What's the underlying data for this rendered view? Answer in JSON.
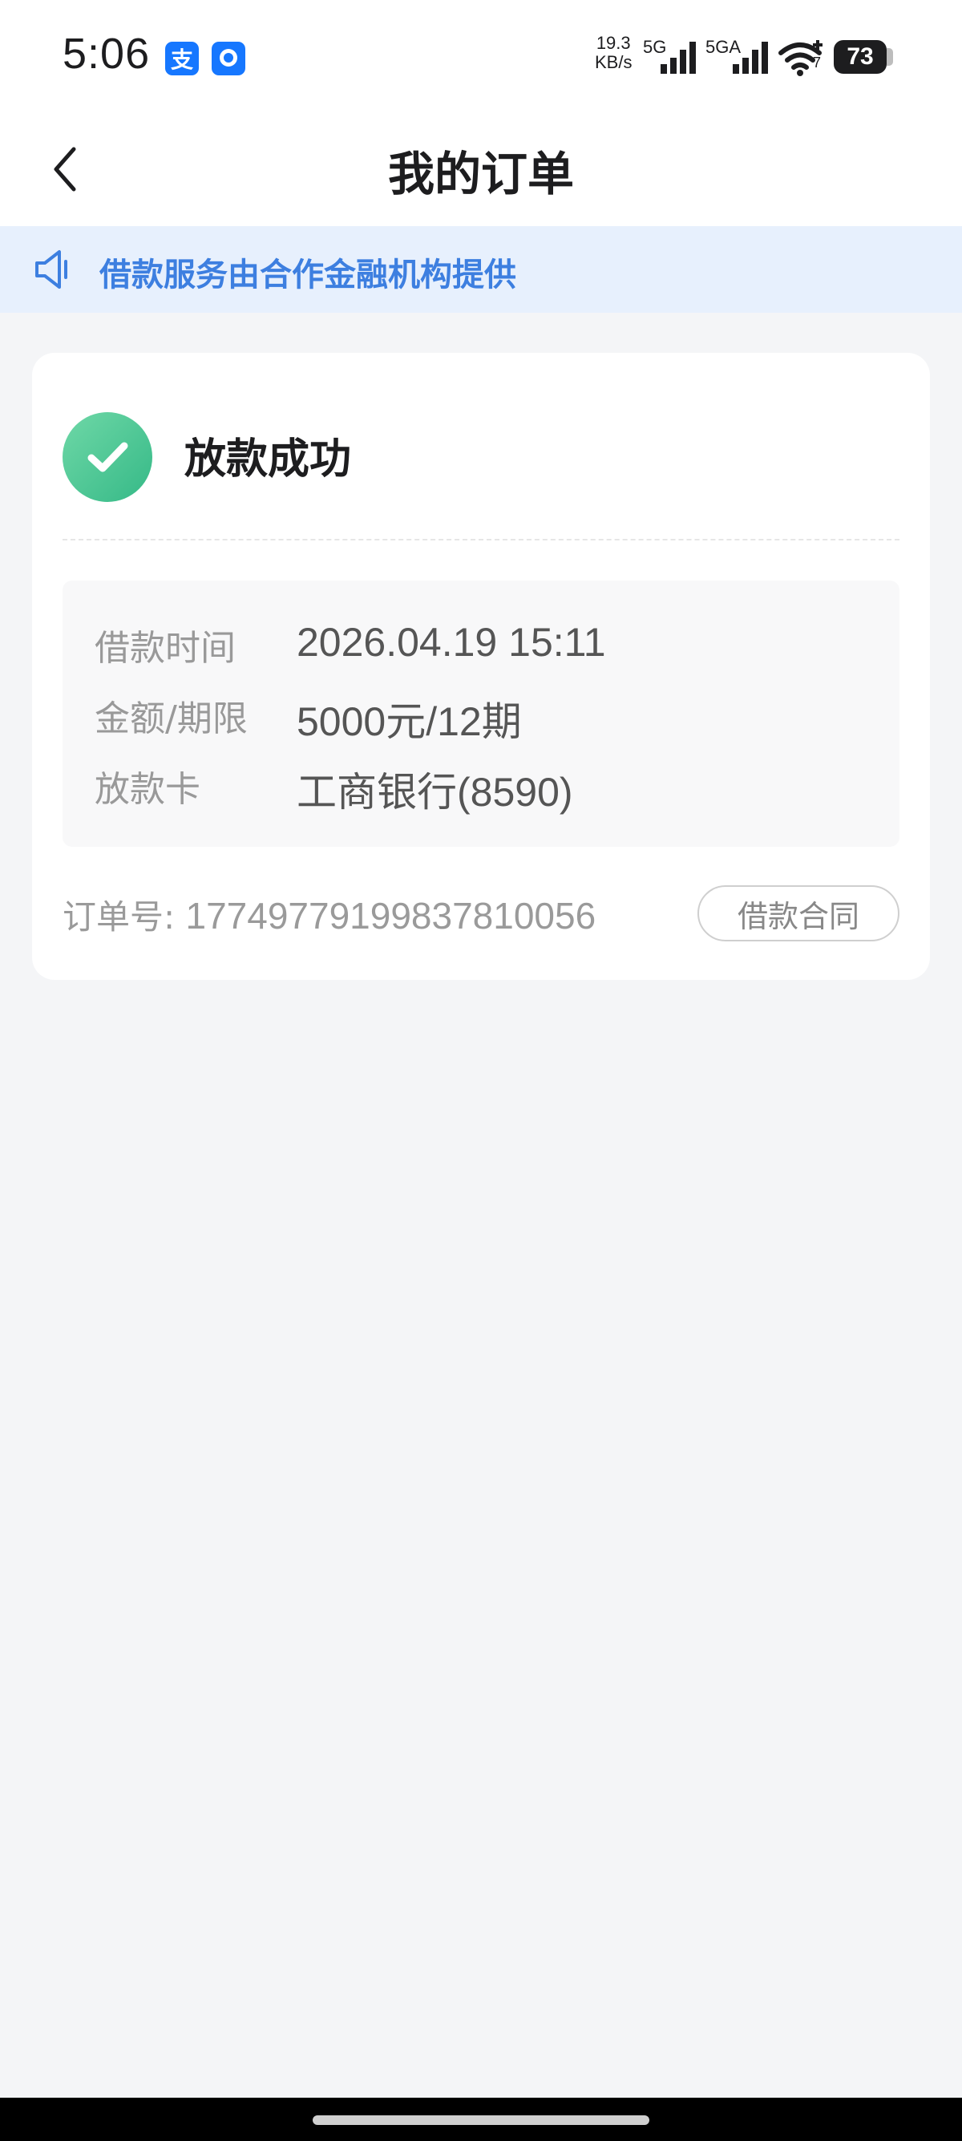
{
  "status_bar": {
    "time": "5:06",
    "app_icons": [
      "alipay-icon",
      "message-app-icon"
    ],
    "alipay_glyph": "支",
    "net_speed_value": "19.3",
    "net_speed_unit": "KB/s",
    "signal_1_label": "5G",
    "signal_2_label": "5GA",
    "wifi_badge": "7",
    "battery": "73"
  },
  "nav": {
    "title": "我的订单"
  },
  "notice": {
    "text": "借款服务由合作金融机构提供"
  },
  "order": {
    "status": "放款成功",
    "details": [
      {
        "label": "借款时间",
        "value": "2026.04.19 15:11"
      },
      {
        "label": "金额/期限",
        "value": "5000元/12期"
      },
      {
        "label": "放款卡",
        "value": "工商银行(8590)"
      }
    ],
    "order_no_label": "订单号:",
    "order_no": "1774977919983781005​6",
    "contract_button": "借款合同"
  },
  "colors": {
    "accent_blue": "#3d7fe0",
    "notice_bg": "#e7f0fd",
    "success_green": "#35b987",
    "page_bg": "#f4f5f7"
  }
}
